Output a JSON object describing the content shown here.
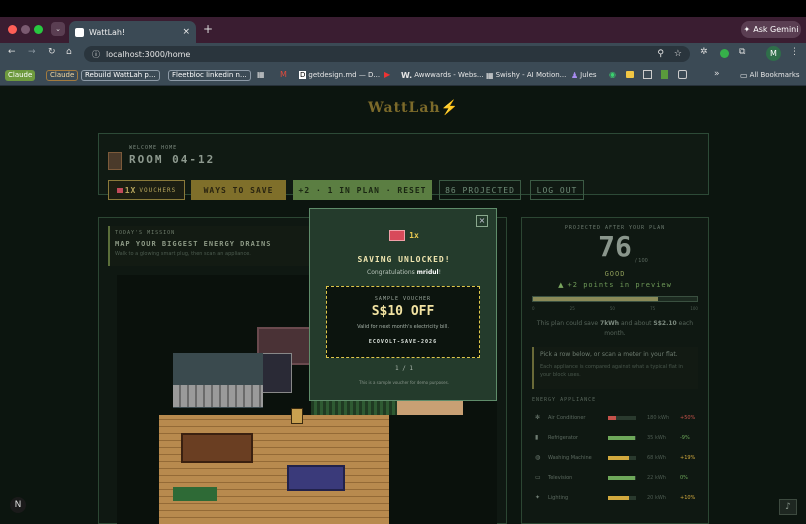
{
  "browser": {
    "tab_title": "WattLah!",
    "url": "localhost:3000/home",
    "ask_gemini": "Ask Gemini",
    "new_tab": "+",
    "close_tab": "×",
    "profile_initial": "M"
  },
  "bookmarks": [
    {
      "label": "Claude",
      "color": "#7aa04a"
    },
    {
      "label": "Claude",
      "color": "#a27a3e"
    },
    {
      "label": "Rebuild WattLah p...",
      "color": "#4c6280"
    },
    {
      "label": "Fleetbloc linkedin n...",
      "color": "#4c7a48"
    },
    {
      "label": "getdesign.md — D..."
    },
    {
      "label": "Awwwards - Webs..."
    },
    {
      "label": "Swishy - AI Motion..."
    },
    {
      "label": "Jules"
    }
  ],
  "all_bookmarks": "All Bookmarks",
  "app": {
    "logo": "WattLah⚡",
    "welcome": "WELCOME HOME",
    "room": "ROOM 04-12",
    "buttons": {
      "vouchers_count": "1X",
      "vouchers": "VOUCHERS",
      "ways": "WAYS TO SAVE",
      "plan": "+2 · 1 IN PLAN · RESET",
      "projected": "86 PROJECTED",
      "logout": "LOG OUT"
    },
    "mission": {
      "label": "TODAY'S MISSION",
      "title": "MAP YOUR BIGGEST ENERGY DRAINS",
      "text": "Walk to a glowing smart plug, then scan an appliance."
    },
    "score": {
      "label": "PROJECTED AFTER YOUR PLAN",
      "value": "76",
      "outof": "/ 100",
      "grade": "GOOD",
      "preview": "+2 points in preview",
      "progress": 0.76,
      "scale": [
        "0",
        "25",
        "50",
        "75",
        "100"
      ],
      "save_prefix": "This plan could save ",
      "kwh": "7kWh",
      "save_mid": " and about ",
      "sgd": "S$2.10",
      "save_suffix": " each month.",
      "pick": "Pick a row below, or scan a meter in your flat.",
      "compare": "Each appliance is compared against what a typical flat in your block uses."
    },
    "appliances_title": "ENERGY APPLIANCE",
    "appliances": [
      {
        "name": "Air Conditioner",
        "kwh": "180 kWh",
        "pct": "+50%",
        "level": 0.3,
        "color": "#c4524a",
        "icon": "snowflake"
      },
      {
        "name": "Refrigerator",
        "kwh": "35 kWh",
        "pct": "-9%",
        "level": 0.95,
        "color": "#6ea85a",
        "icon": "fridge"
      },
      {
        "name": "Washing Machine",
        "kwh": "68 kWh",
        "pct": "+19%",
        "level": 0.75,
        "color": "#d2a93e",
        "icon": "washer"
      },
      {
        "name": "Television",
        "kwh": "22 kWh",
        "pct": "0%",
        "level": 0.95,
        "color": "#6ea85a",
        "icon": "tv"
      },
      {
        "name": "Lighting",
        "kwh": "20 kWh",
        "pct": "+10%",
        "level": 0.75,
        "color": "#d2a93e",
        "icon": "bulb"
      }
    ]
  },
  "modal": {
    "count": "1x",
    "title": "SAVING UNLOCKED!",
    "congrats_prefix": "Congratulations ",
    "user": "mridul",
    "congrats_suffix": "!",
    "sample": "SAMPLE VOUCHER",
    "amount": "S$10 OFF",
    "valid": "Valid for next month's electricity bill.",
    "code": "ECOVOLT-SAVE-2026",
    "pager": "1 / 1",
    "note": "This is a sample voucher for demo purposes.",
    "close": "×"
  },
  "colors": {
    "accent": "#d8b948",
    "green": "#8fd06d",
    "panel": "#0f1812"
  }
}
